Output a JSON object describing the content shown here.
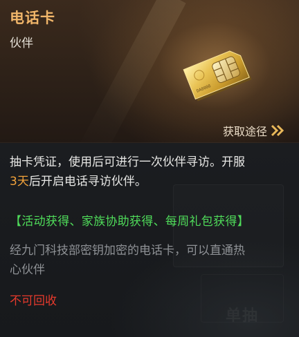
{
  "item": {
    "name": "电话卡",
    "type": "伙伴",
    "card_text": "DA8008",
    "source_link_label": "获取途径"
  },
  "description": {
    "line1": "抽卡凭证，使用后可进行一次伙伴寻访。开服",
    "line2_highlight": "3天",
    "line2_rest": "后开启电话寻访伙伴。"
  },
  "sources_text": "【活动获得、家族协助获得、每周礼包获得】",
  "flavor": {
    "line1": "经九门科技部密钥加密的电话卡，可以直通热",
    "line2": "心伙伴"
  },
  "recycle_status": "不可回收",
  "background_label": "单抽",
  "colors": {
    "name": "#f1b66a",
    "highlight": "#f3a33b",
    "sources": "#4fdc5a",
    "warning": "#e63a2c",
    "flavor": "#8f9296"
  },
  "icons": {
    "card": "sim-card-icon",
    "source_arrow": "double-chevron-right-icon"
  }
}
